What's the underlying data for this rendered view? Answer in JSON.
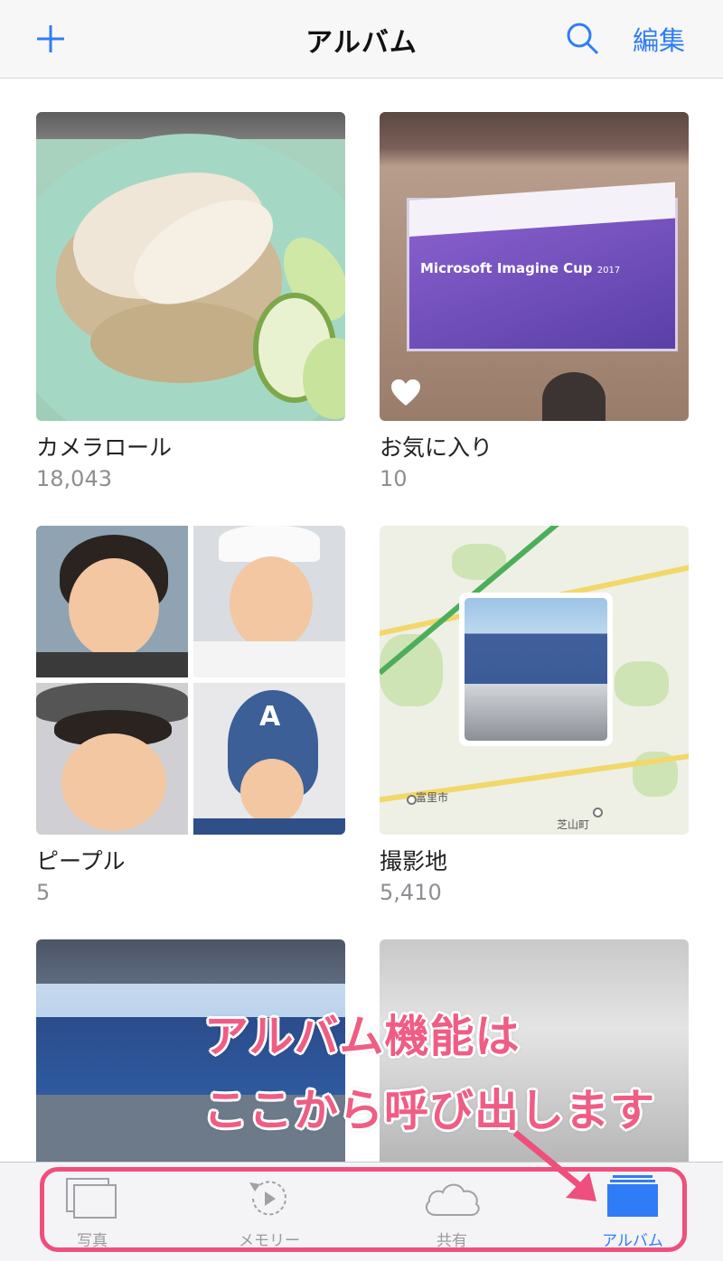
{
  "navbar": {
    "title": "アルバム",
    "edit_label": "編集",
    "icons": [
      "plus-icon",
      "search-icon"
    ],
    "accent_color": "#2f7cf6"
  },
  "albums": [
    {
      "name": "カメラロール",
      "count": "18,043"
    },
    {
      "name": "お気に入り",
      "count": "10"
    },
    {
      "name": "ピープル",
      "count": "5"
    },
    {
      "name": "撮影地",
      "count": "5,410"
    }
  ],
  "presentation_slide": {
    "title": "Microsoft Imagine Cup",
    "year": "2017"
  },
  "map_labels": [
    "富里市",
    "芝山町"
  ],
  "callout": {
    "line1": "アルバム機能は",
    "line2": "ここから呼び出します",
    "color": "#ef5d84"
  },
  "tabbar": {
    "tabs": [
      {
        "label": "写真",
        "icon": "photos-icon"
      },
      {
        "label": "メモリー",
        "icon": "memories-icon"
      },
      {
        "label": "共有",
        "icon": "cloud-icon"
      },
      {
        "label": "アルバム",
        "icon": "albums-icon",
        "active": true
      }
    ]
  }
}
